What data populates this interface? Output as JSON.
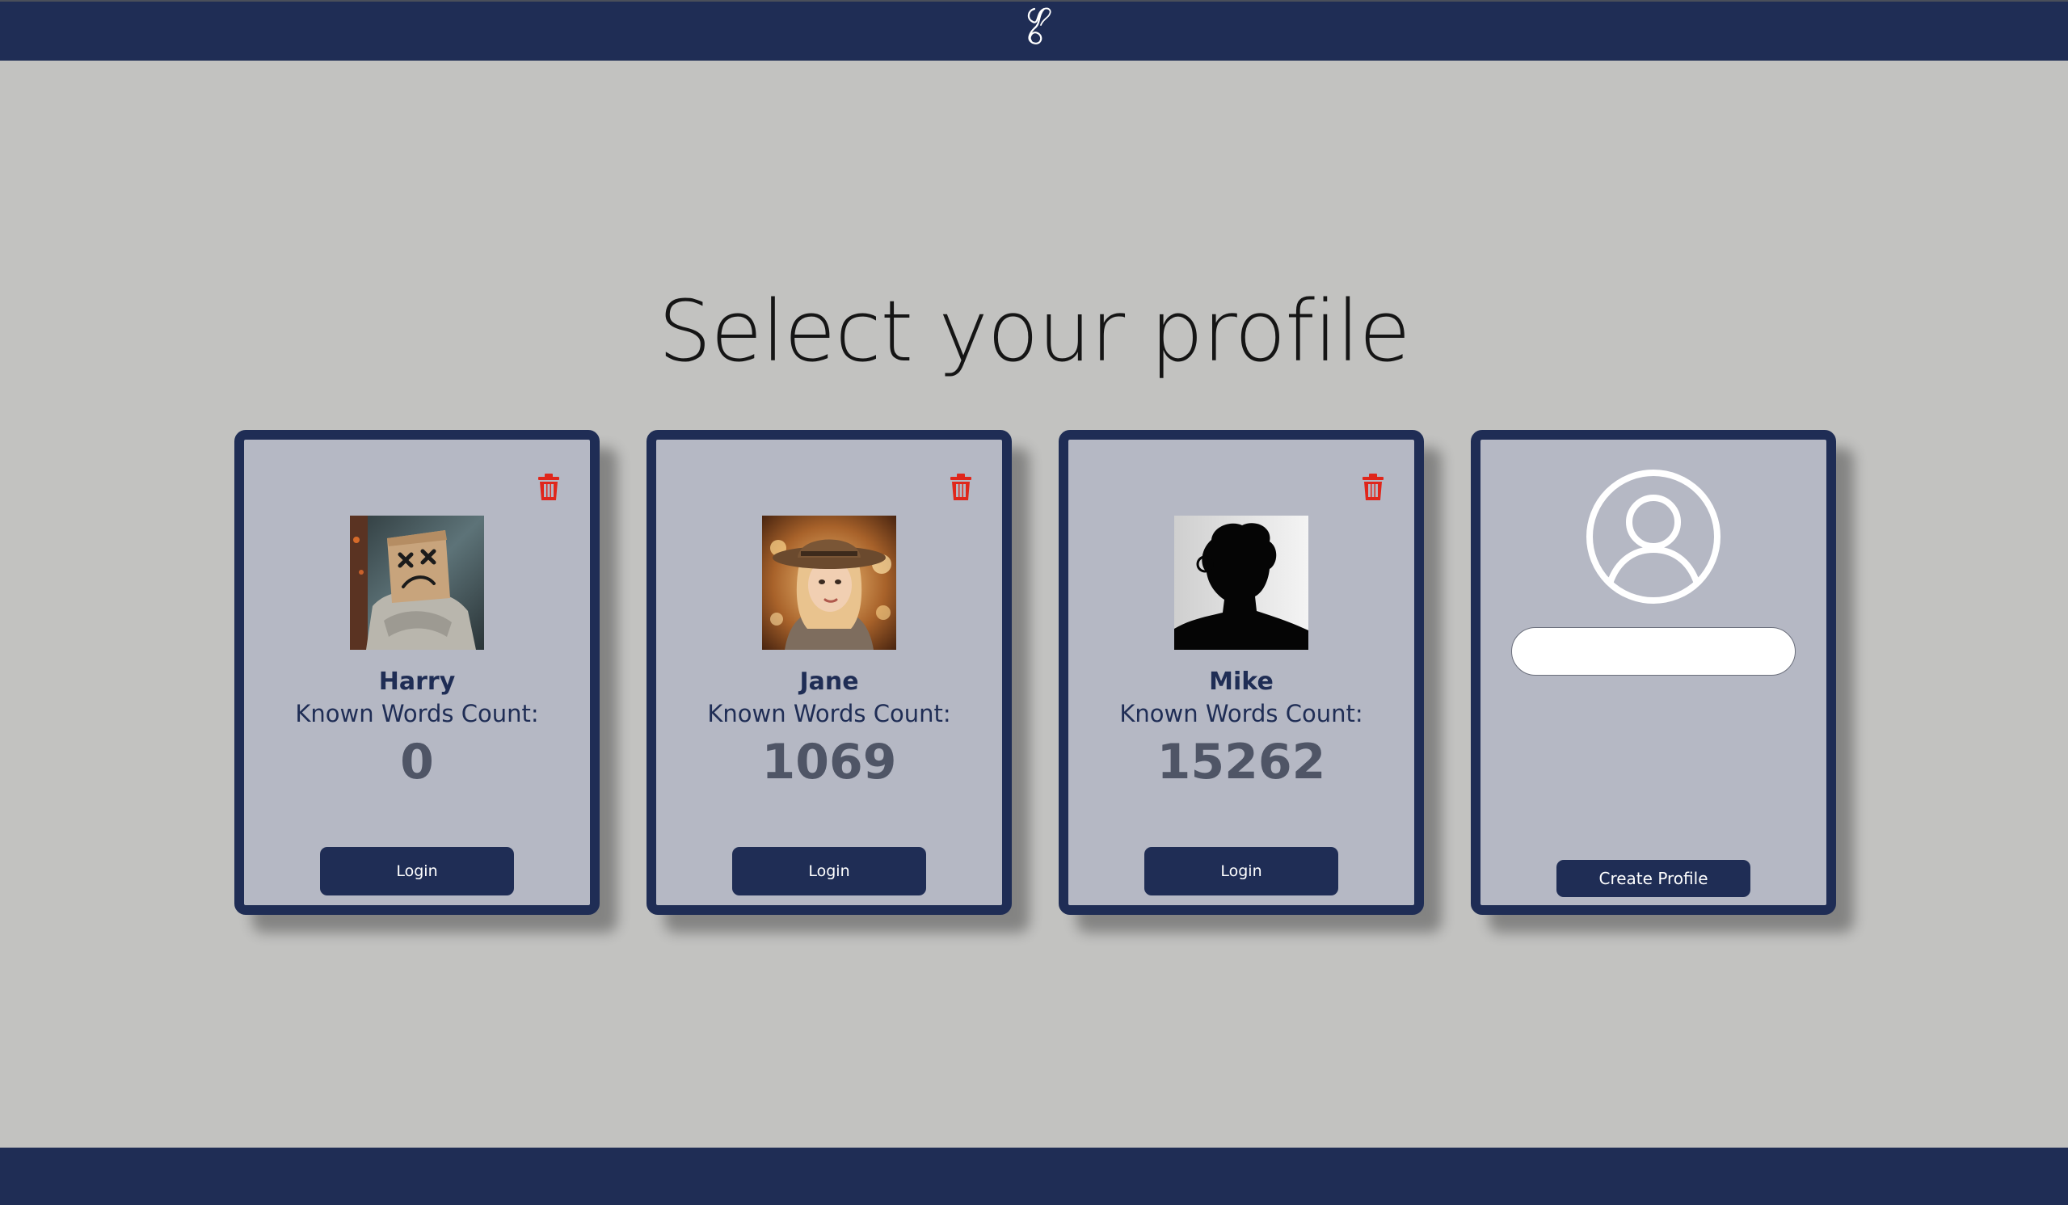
{
  "header": {
    "logo_icon": "quill-logo-icon"
  },
  "page": {
    "title": "Select your profile"
  },
  "profiles": [
    {
      "name": "Harry",
      "words_label": "Known Words Count:",
      "count": "0",
      "login_label": "Login",
      "avatar": "paper-bag-person-image"
    },
    {
      "name": "Jane",
      "words_label": "Known Words Count:",
      "count": "1069",
      "login_label": "Login",
      "avatar": "woman-with-hat-image"
    },
    {
      "name": "Mike",
      "words_label": "Known Words Count:",
      "count": "15262",
      "login_label": "Login",
      "avatar": "silhouette-image"
    }
  ],
  "new_profile": {
    "avatar_icon": "user-circle-icon",
    "name_input_value": "",
    "name_input_placeholder": "",
    "create_label": "Create Profile"
  },
  "colors": {
    "navy": "#1f2d55",
    "card_bg": "#b5b8c4",
    "page_bg": "#c2c2c0",
    "delete_red": "#e0261b",
    "count_gray": "#4f5566"
  }
}
